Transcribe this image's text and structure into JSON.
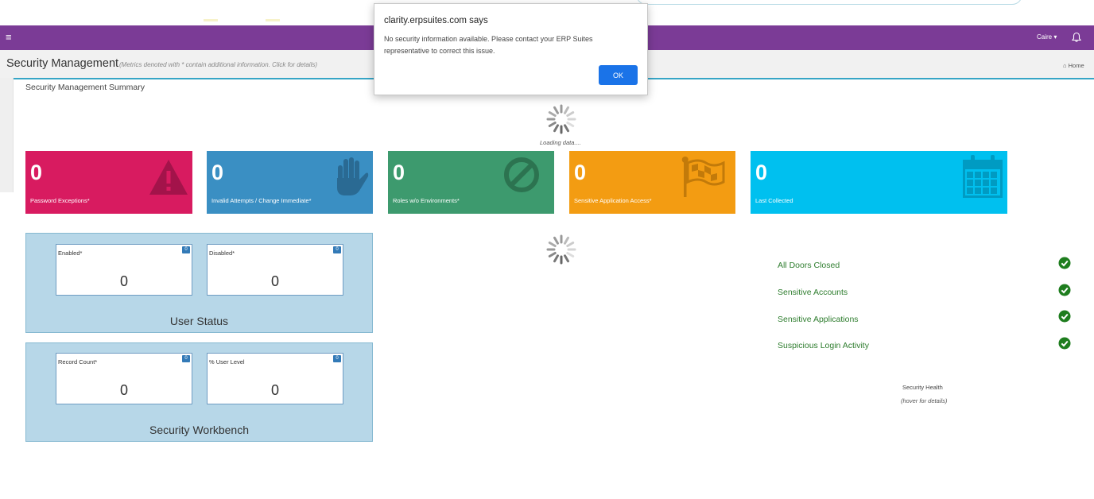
{
  "navbar": {
    "menu_glyph": "≡",
    "user_label": "Caire ▾"
  },
  "header": {
    "title": "Security Management",
    "subtitle": "(Metrics denoted with * contain additional information. Click for details)",
    "breadcrumb": "Home"
  },
  "summary": {
    "title": "Security Management Summary",
    "loading": "Loading data...."
  },
  "tiles": [
    {
      "value": "0",
      "label": "Password Exceptions*",
      "color": "#d81b60",
      "icon": "warning-icon"
    },
    {
      "value": "0",
      "label": "Invalid Attempts / Change Immediate*",
      "color": "#3a8fc3",
      "icon": "hand-icon"
    },
    {
      "value": "0",
      "label": "Roles w/o Environments*",
      "color": "#3d9a6e",
      "icon": "ban-icon"
    },
    {
      "value": "0",
      "label": "Sensitive Application Access*",
      "color": "#f39c12",
      "icon": "flag-icon"
    },
    {
      "value": "0",
      "label": "Last Collected",
      "color": "#00c0ef",
      "icon": "calendar-icon"
    }
  ],
  "user_status": {
    "title": "User Status",
    "metrics": [
      {
        "label": "Enabled*",
        "value": "0",
        "badge": "0"
      },
      {
        "label": "Disabled*",
        "value": "0",
        "badge": "0"
      }
    ]
  },
  "workbench": {
    "title": "Security Workbench",
    "metrics": [
      {
        "label": "Record Count*",
        "value": "0",
        "badge": "0"
      },
      {
        "label": "% User Level",
        "value": "0",
        "badge": "0"
      }
    ]
  },
  "health": {
    "items": [
      {
        "label": "All Doors Closed"
      },
      {
        "label": "Sensitive Accounts"
      },
      {
        "label": "Sensitive Applications"
      },
      {
        "label": "Suspicious Login Activity"
      }
    ],
    "title": "Security Health",
    "hint": "(hover for details)",
    "check_color": "#1e7d1e"
  },
  "dialog": {
    "title": "clarity.erpsuites.com says",
    "message": "No security information available. Please contact your ERP Suites representative to correct this issue.",
    "ok_label": "OK"
  }
}
